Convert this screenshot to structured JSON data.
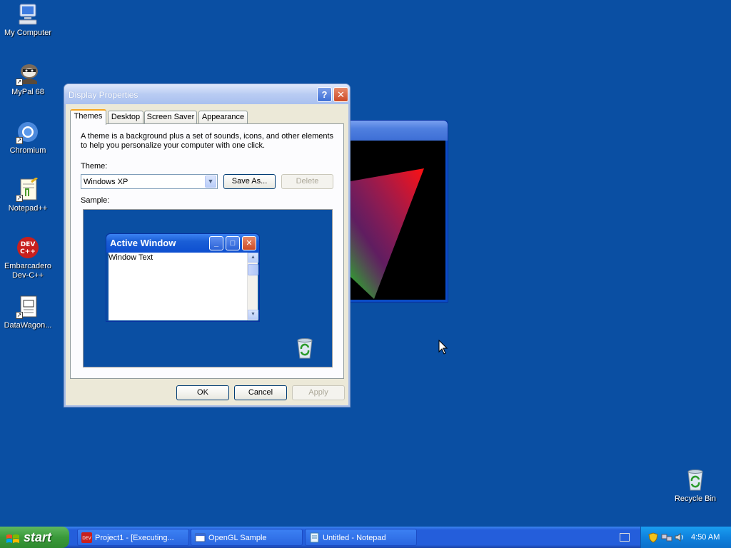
{
  "desktop": {
    "icons": [
      {
        "label": "My Computer",
        "icon": "computer-icon"
      },
      {
        "label": "MyPal 68",
        "icon": "raccoon-icon"
      },
      {
        "label": "Chromium",
        "icon": "chromium-icon"
      },
      {
        "label": "Notepad++",
        "icon": "notepadpp-icon"
      },
      {
        "label": "Embarcadero Dev-C++",
        "icon": "devcpp-icon"
      },
      {
        "label": "DataWagon...",
        "icon": "document-icon"
      }
    ],
    "recycle_bin": {
      "label": "Recycle Bin",
      "icon": "recycle-bin-icon"
    }
  },
  "dialog": {
    "title": "Display Properties",
    "help_label": "?",
    "close_label": "✕",
    "tabs": [
      {
        "label": "Themes"
      },
      {
        "label": "Desktop"
      },
      {
        "label": "Screen Saver"
      },
      {
        "label": "Appearance"
      }
    ],
    "description": "A theme is a background plus a set of sounds, icons, and other elements to help you personalize your computer with one click.",
    "theme_label": "Theme:",
    "theme_value": "Windows XP",
    "save_as_label": "Save As...",
    "delete_label": "Delete",
    "sample_label": "Sample:",
    "sample": {
      "window_title": "Active Window",
      "window_text": "Window Text"
    },
    "ok_label": "OK",
    "cancel_label": "Cancel",
    "apply_label": "Apply"
  },
  "taskbar": {
    "start_label": "start",
    "tasks": [
      {
        "label": "Project1 - [Executing...",
        "icon": "devcpp-icon"
      },
      {
        "label": "OpenGL Sample",
        "icon": "window-icon"
      },
      {
        "label": "Untitled - Notepad",
        "icon": "notepad-icon"
      }
    ],
    "clock": "4:50 AM"
  },
  "colors": {
    "desktop": "#0a4fa3",
    "dialog_bg": "#ece9d8",
    "taskbar": "#245edb",
    "start": "#3a9a3a",
    "tray": "#0f82de"
  }
}
